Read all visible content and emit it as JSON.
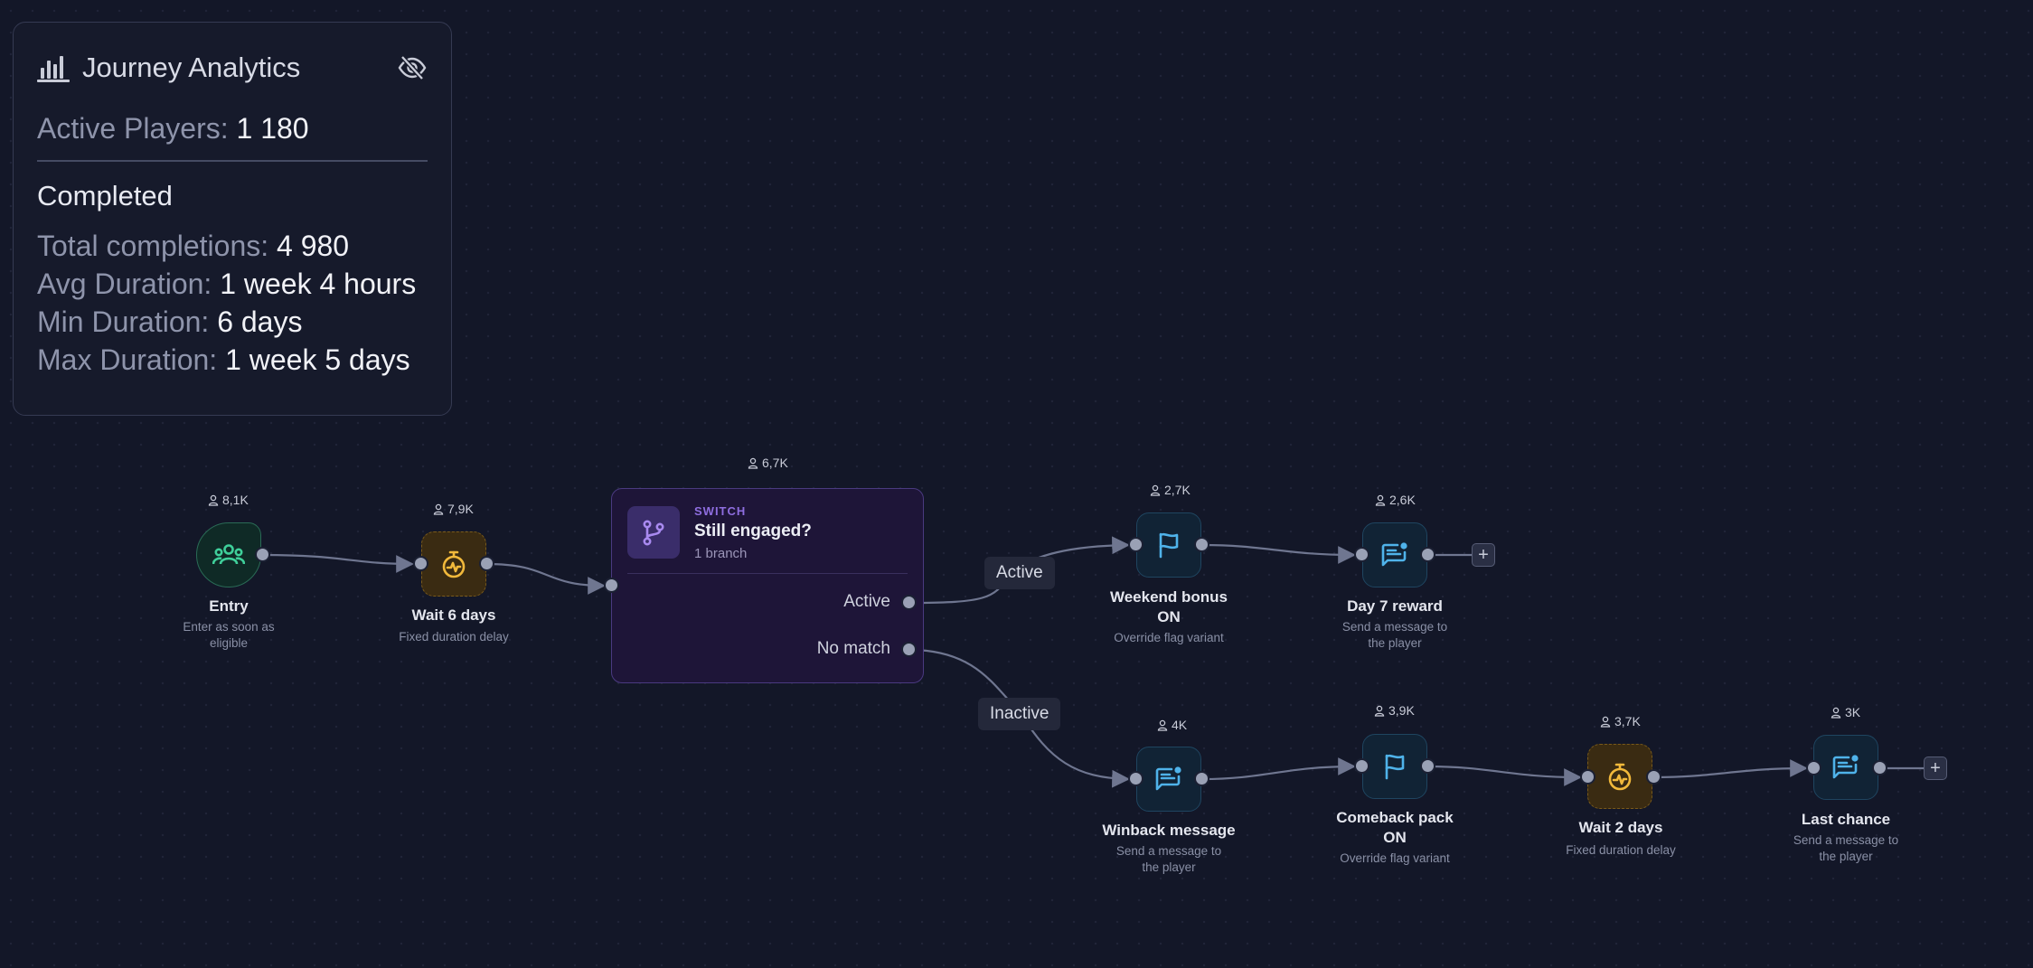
{
  "analytics": {
    "title": "Journey Analytics",
    "active_players_label": "Active Players:",
    "active_players_value": "1 180",
    "completed_title": "Completed",
    "total_label": "Total completions:",
    "total_value": "4 980",
    "avg_label": "Avg Duration:",
    "avg_value": "1 week 4 hours",
    "min_label": "Min Duration:",
    "min_value": "6 days",
    "max_label": "Max Duration:",
    "max_value": "1 week 5 days"
  },
  "nodes": {
    "entry": {
      "count": "8,1K",
      "title": "Entry",
      "sub1": "Enter as soon as",
      "sub2": "eligible",
      "icon": "users-icon"
    },
    "wait6": {
      "count": "7,9K",
      "title": "Wait 6 days",
      "sub1": "Fixed duration delay",
      "icon": "stopwatch-icon"
    },
    "switch": {
      "count": "6,7K",
      "kind": "SWITCH",
      "title": "Still engaged?",
      "sub": "1 branch",
      "branch_active": "Active",
      "branch_nomatch": "No match"
    },
    "weekend": {
      "count": "2,7K",
      "title1": "Weekend bonus",
      "title2": "ON",
      "sub1": "Override flag variant",
      "icon": "flag-icon"
    },
    "day7": {
      "count": "2,6K",
      "title": "Day 7 reward",
      "sub1": "Send a message to",
      "sub2": "the player",
      "icon": "message-icon"
    },
    "winback": {
      "count": "4K",
      "title": "Winback message",
      "sub1": "Send a message to",
      "sub2": "the player",
      "icon": "message-icon"
    },
    "comeback": {
      "count": "3,9K",
      "title1": "Comeback pack",
      "title2": "ON",
      "sub1": "Override flag variant",
      "icon": "flag-icon"
    },
    "wait2": {
      "count": "3,7K",
      "title": "Wait 2 days",
      "sub1": "Fixed duration delay",
      "icon": "stopwatch-icon"
    },
    "last": {
      "count": "3K",
      "title": "Last chance",
      "sub1": "Send a message to",
      "sub2": "the player",
      "icon": "message-icon"
    }
  },
  "edge_labels": {
    "active": "Active",
    "inactive": "Inactive"
  },
  "add_label": "+",
  "colors": {
    "background": "#131728",
    "entry": "#3fcf9a",
    "wait": "#f2b93b",
    "message": "#4fb3ea",
    "switch": "#8f6ee0",
    "edge": "#6f7690"
  }
}
